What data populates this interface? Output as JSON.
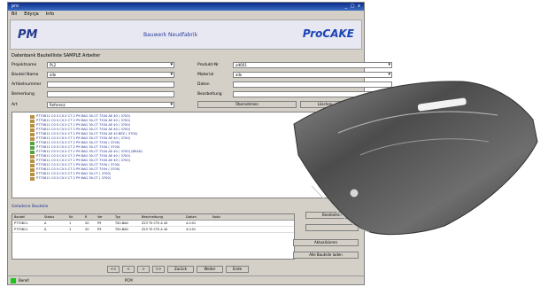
{
  "window": {
    "title": "pro",
    "controls": "_ □ x"
  },
  "menu": [
    "Bil",
    "Edycja",
    "Info"
  ],
  "header": {
    "left_logo": "PM",
    "app_title": "Bauwerk Neudfabrik",
    "brand": "ProCAKE",
    "brand_sub": ""
  },
  "section": {
    "label": "Datenbank Bauteilliste SAMPLE Arbeiter"
  },
  "form": {
    "row1": {
      "label": "Projektname",
      "value": "PL2",
      "label2": "Produkt-Nr",
      "value2": "alt001"
    },
    "row2": {
      "label": "Bauteil Name",
      "value": "alle",
      "label2": "Material",
      "value2": "alle"
    },
    "row3": {
      "label": "Artikelnummer",
      "value": "",
      "label2": "Daten",
      "value2": ""
    },
    "row4": {
      "label": "Bemerkung",
      "value": "",
      "label2": "Bearbeitung",
      "value2": ""
    },
    "row5": {
      "label": "Art",
      "value": "Referenz",
      "btn1": "Übernehmen",
      "btn2": "Löschen"
    }
  },
  "tree": [
    {
      "text": "P7T0811 C0 0 C0.5 CT 2 P9 BAG 30-CT 7534 AE 40 ( 3700)",
      "color": "#1c2f8f",
      "icon": "#b89040"
    },
    {
      "text": "P7T0811 C0 0 C0.5 CT 2 P9 BAG 30-CT 7534 AE 40 ( 3700)",
      "color": "#1c2f8f",
      "icon": "#b89040"
    },
    {
      "text": "P7T0811 C0 0 C0.5 CT 2 P9 BAG 30-CT 7534 AE 40 ( 3700)",
      "color": "#1c2f8f",
      "icon": "#b89040"
    },
    {
      "text": "P7T0811 C0 0 C0.5 CT 2 P9 BAG 30-CT 7534 AE 40 ( 3700)",
      "color": "#1c2f8f",
      "icon": "#b89040"
    },
    {
      "text": "P7T0811 C0 0 C0.5 CT 2 P9 BAG 30-CT 7534 AE 40 BEZ ( 3700)",
      "color": "#1c2f8f",
      "icon": "#b89040"
    },
    {
      "text": "P7T0811 C0 0 C0.5 CT 2 P9 BAG 30-CT 7534 AE 40 ( 3700)",
      "color": "#1c2f8f",
      "icon": "#b89040"
    },
    {
      "text": "P7T0811 C0 0 C0.5 CT 2 P9 BAG 30-CT 7534 ( 3700)",
      "color": "#1c2f8f",
      "icon": "#55a040"
    },
    {
      "text": "P7T0811 C0 0 C0.5 CT 2 P9 BAG 30-CT 7534 ( 3700)",
      "color": "#1c2f8f",
      "icon": "#55a040"
    },
    {
      "text": "P7T0811 C0 0 C0.5 CT 2 P9 BAG 30-CT 7534 AE 40 ( 3700) (BEAD)",
      "color": "#1c2f8f",
      "icon": "#55a040"
    },
    {
      "text": "P7T0811 C0 0 C0.5 CT 2 P9 BAG 30-CT 7534 AE 40 ( 3700)",
      "color": "#1c2f8f",
      "icon": "#b89040"
    },
    {
      "text": "P7T0811 C0 0 C0.5 CT 2 P9 BAG 30-CT 7534 AE 40 ( 3700)",
      "color": "#1c2f8f",
      "icon": "#b89040"
    },
    {
      "text": "P7T0811 C0 0 C0.5 CT 2 P9 BAG 30-CT 7534 ( 3700)",
      "color": "#1c2f8f",
      "icon": "#b89040"
    },
    {
      "text": "P7T0811 C0 0 C0.5 CT 2 P9 BAG 30-CT 7534 ( 3700)",
      "color": "#1c2f8f",
      "icon": "#b89040"
    },
    {
      "text": "P7T0811 C0 0 C0.5 CT 2 P9 BAG 30-CT ( 3700)",
      "color": "#1c2f8f",
      "icon": "#b89040"
    },
    {
      "text": "P7T0811 C0 0 C0.5 CT 2 P9 BAG 30-CT ( 3700)",
      "color": "#1c2f8f",
      "icon": "#b89040"
    }
  ],
  "grid_label": "Geladene Bauteile",
  "grid": {
    "headers": [
      "Bauteil",
      "Status",
      "Nr.",
      "R",
      "Ver",
      "Typ",
      "Beschreibung",
      "Datum",
      "Notiz"
    ],
    "rows": [
      [
        "P7T0811",
        "A",
        "1",
        "20",
        "P9",
        "TS0.BAG",
        "Z23 T0 CT0 A 40",
        "4.0.01",
        ""
      ],
      [
        "P7T0811",
        "A",
        "1",
        "20",
        "P9",
        "TS0.BAG",
        "Z23 T0 CT0 A 40",
        "4.0.01",
        ""
      ]
    ]
  },
  "right_buttons": {
    "b1": "Bearbeiten",
    "b2": "",
    "b3": "Aktualisieren",
    "b4": "Alle Bauteile laden"
  },
  "nav_buttons": [
    "<<",
    "<",
    ">",
    ">>",
    "Zurück",
    "Weiter",
    "Ende"
  ],
  "status": {
    "left": "Bereit",
    "center": "PCM"
  },
  "colors": {
    "title_bar": "#0b2a8a",
    "brand": "#1b43b8",
    "status_ok": "#1ec51e"
  }
}
